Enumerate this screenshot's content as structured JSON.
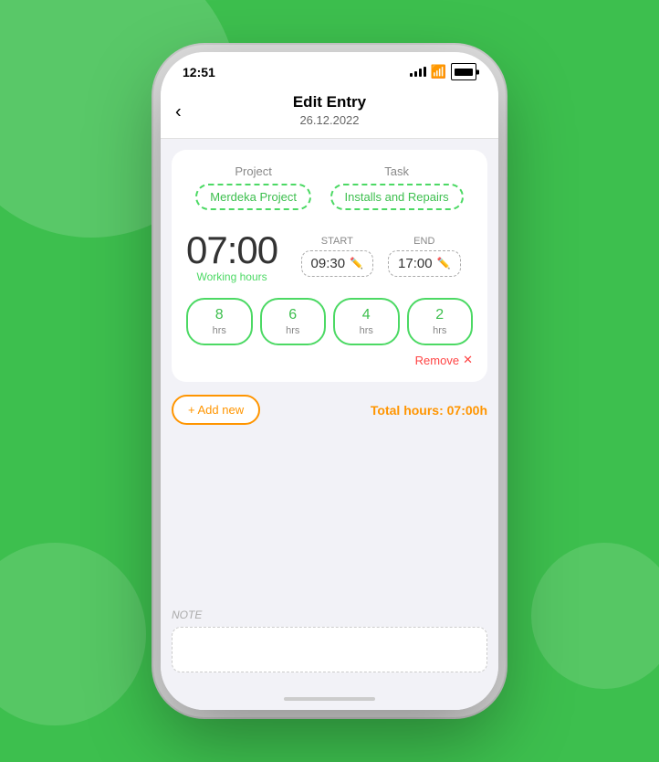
{
  "background": {
    "color": "#3dbf4e"
  },
  "statusBar": {
    "time": "12:51"
  },
  "header": {
    "backLabel": "‹",
    "title": "Edit Entry",
    "date": "26.12.2022"
  },
  "projectTask": {
    "projectLabel": "Project",
    "projectValue": "Merdeka Project",
    "taskLabel": "Task",
    "taskValue": "Installs and Repairs"
  },
  "timeEntry": {
    "mainTime": "07:00",
    "workingHoursLabel": "Working hours",
    "startLabel": "START",
    "startValue": "09:30",
    "endLabel": "END",
    "endValue": "17:00"
  },
  "hourButtons": [
    {
      "value": "8",
      "label": "hrs"
    },
    {
      "value": "6",
      "label": "hrs"
    },
    {
      "value": "4",
      "label": "hrs"
    },
    {
      "value": "2",
      "label": "hrs"
    }
  ],
  "removeButton": "Remove",
  "addNewButton": "+ Add new",
  "totalHours": "Total hours: 07:00h",
  "noteSection": {
    "label": "NOTE",
    "placeholder": ""
  }
}
